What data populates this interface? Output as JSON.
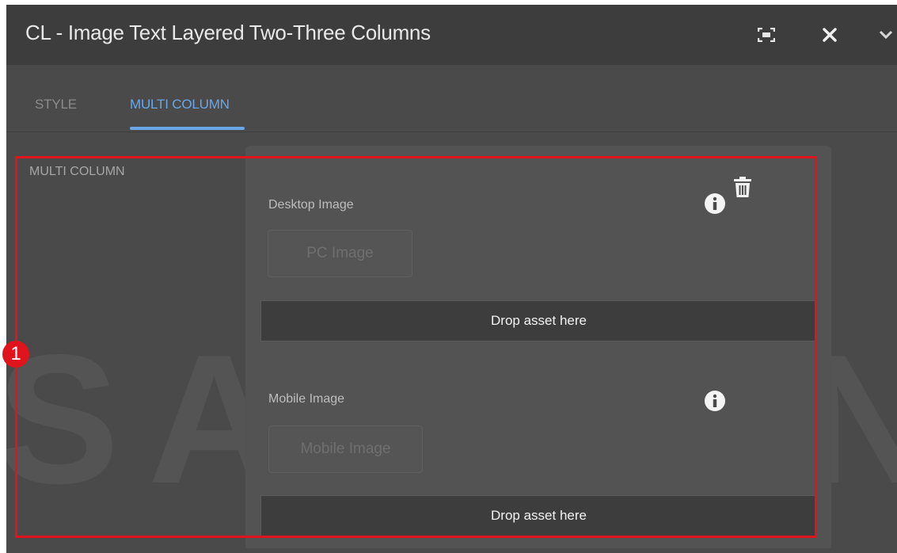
{
  "dialog": {
    "title": "CL - Image Text Layered Two-Three Columns",
    "icons": [
      "fullscreen-icon",
      "close-icon",
      "chevron-down-icon"
    ]
  },
  "tabs": [
    {
      "label": "STYLE",
      "active": false
    },
    {
      "label": "MULTI COLUMN",
      "active": true
    }
  ],
  "section": {
    "label": "MULTI COLUMN"
  },
  "desktop": {
    "label": "Desktop Image",
    "button": "PC Image",
    "drop": "Drop asset here"
  },
  "mobile": {
    "label": "Mobile Image",
    "button": "Mobile Image",
    "drop": "Drop asset here"
  },
  "watermark": "SAMSUNG",
  "annotation": {
    "number": "1",
    "color": "#e0141d"
  },
  "colors": {
    "accent": "#6aa7e8",
    "background": "#4a4a4a",
    "titlebar": "#3d3d3d"
  }
}
